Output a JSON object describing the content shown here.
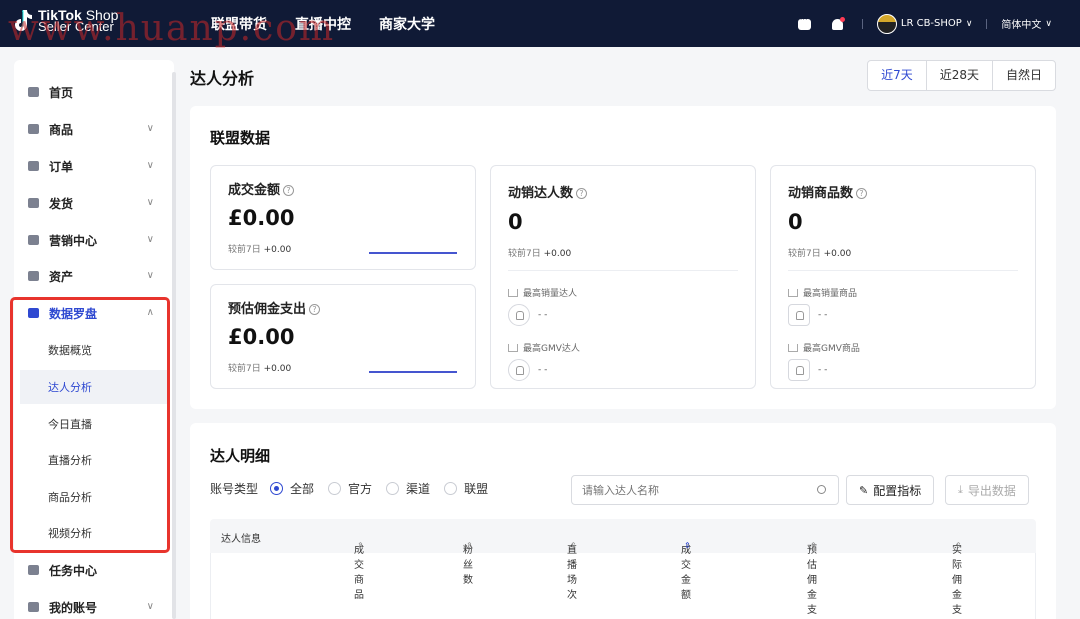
{
  "watermark": "www.huanp.com",
  "header": {
    "logo_line1": "TikTok",
    "logo_line1_suffix": "Shop",
    "logo_line2": "Seller Center",
    "nav": [
      "联盟带货",
      "直播中控",
      "商家大学"
    ],
    "shop_name": "LR CB-SHOP",
    "language": "简体中文"
  },
  "sidebar": {
    "items": [
      {
        "label": "首页",
        "icon": "home-icon"
      },
      {
        "label": "商品",
        "icon": "product-icon"
      },
      {
        "label": "订单",
        "icon": "order-icon"
      },
      {
        "label": "发货",
        "icon": "truck-icon"
      },
      {
        "label": "营销中心",
        "icon": "megaphone-icon"
      },
      {
        "label": "资产",
        "icon": "wallet-icon"
      },
      {
        "label": "数据罗盘",
        "icon": "bar-chart-icon"
      }
    ],
    "sub_items": [
      "数据概览",
      "达人分析",
      "今日直播",
      "直播分析",
      "商品分析",
      "视频分析"
    ],
    "active_sub": "达人分析",
    "bottom_items": [
      {
        "label": "任务中心",
        "icon": "medal-icon"
      },
      {
        "label": "我的账号",
        "icon": "user-icon"
      }
    ]
  },
  "page": {
    "title": "达人分析",
    "ranges": [
      "近7天",
      "近28天",
      "自然日"
    ],
    "active_range": "近7天"
  },
  "alliance": {
    "title": "联盟数据",
    "cards": {
      "gmv": {
        "title": "成交金额",
        "value": "£0.00",
        "compare_label": "较前7日",
        "compare_value": "+0.00"
      },
      "commission": {
        "title": "预估佣金支出",
        "value": "£0.00",
        "compare_label": "较前7日",
        "compare_value": "+0.00"
      },
      "creators": {
        "title": "动销达人数",
        "value": "0",
        "compare_label": "较前7日",
        "compare_value": "+0.00",
        "top_sales_label": "最高销量达人",
        "top_sales_value": "- -",
        "top_gmv_label": "最高GMV达人",
        "top_gmv_value": "- -"
      },
      "products": {
        "title": "动销商品数",
        "value": "0",
        "compare_label": "较前7日",
        "compare_value": "+0.00",
        "top_sales_label": "最高销量商品",
        "top_sales_value": "- -",
        "top_gmv_label": "最高GMV商品",
        "top_gmv_value": "- -"
      }
    }
  },
  "detail": {
    "title": "达人明细",
    "account_type_label": "账号类型",
    "account_types": [
      "全部",
      "官方",
      "渠道",
      "联盟"
    ],
    "selected_type": "全部",
    "search_placeholder": "请输入达人名称",
    "config_button": "配置指标",
    "export_button": "导出数据",
    "columns": [
      "达人信息",
      "成交商品",
      "粉丝数",
      "直播场次",
      "成交金额",
      "预估佣金支出",
      "实际佣金支出"
    ]
  },
  "colors": {
    "topbar": "#101a36",
    "accent": "#2f49d1",
    "highlight_box": "#e8342d"
  }
}
